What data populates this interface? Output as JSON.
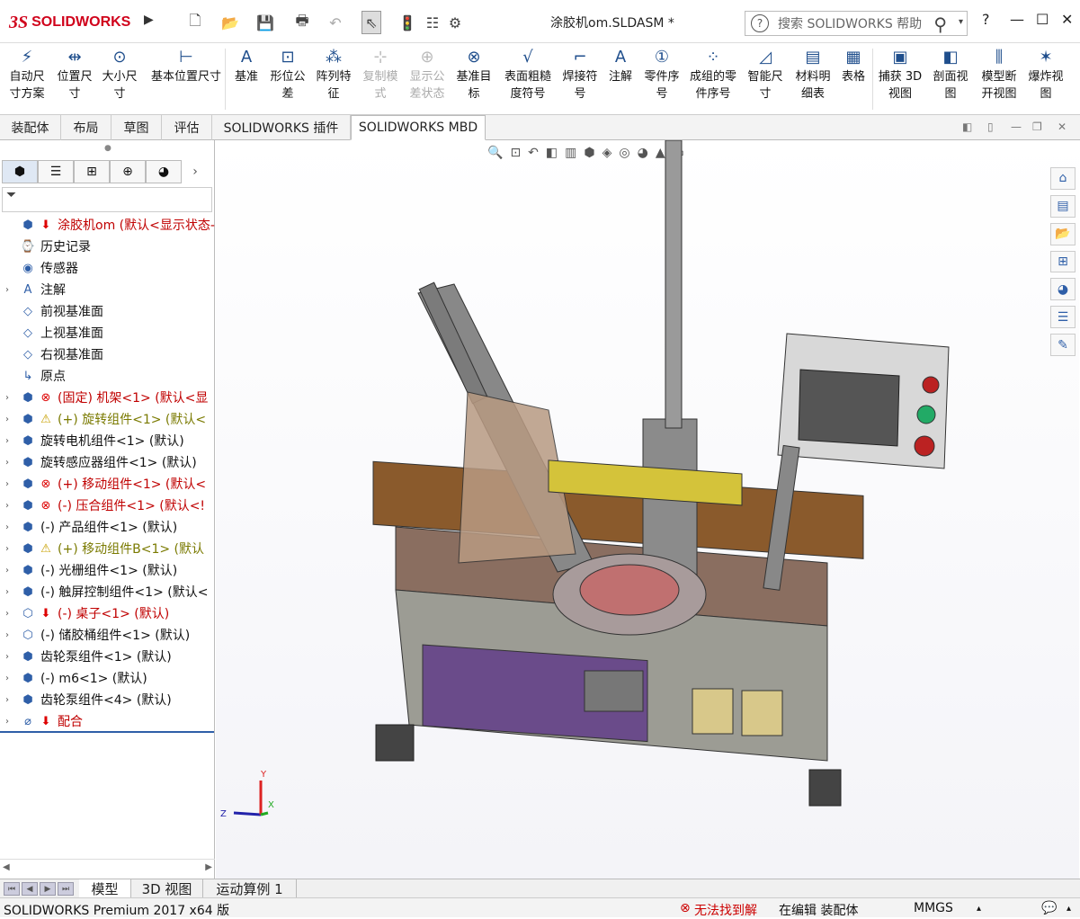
{
  "app": {
    "logo_mark": "3S",
    "logo_text": "SOLIDWORKS",
    "doc_title": "涂胶机om.SLDASM *"
  },
  "search": {
    "placeholder": "搜索 SOLIDWORKS 帮助",
    "help": "?"
  },
  "window": {
    "help": "?",
    "minimize": "—",
    "maximize": "☐",
    "close": "✕"
  },
  "ribbon": [
    {
      "label1": "自动尺",
      "label2": "寸方案",
      "icon": "⚡",
      "enabled": true
    },
    {
      "label1": "位置尺",
      "label2": "寸",
      "icon": "⇹",
      "enabled": true
    },
    {
      "label1": "大小尺",
      "label2": "寸",
      "icon": "⊙",
      "enabled": true
    },
    {
      "label1": "基本位置尺寸",
      "label2": "",
      "icon": "⊢",
      "enabled": true
    },
    {
      "label1": "基准",
      "label2": "",
      "icon": "A",
      "enabled": true
    },
    {
      "label1": "形位公",
      "label2": "差",
      "icon": "⊡",
      "enabled": true
    },
    {
      "label1": "阵列特",
      "label2": "征",
      "icon": "⁂",
      "enabled": true
    },
    {
      "label1": "复制模",
      "label2": "式",
      "icon": "⊹",
      "enabled": false
    },
    {
      "label1": "显示公",
      "label2": "差状态",
      "icon": "⊕",
      "enabled": false
    },
    {
      "label1": "基准目",
      "label2": "标",
      "icon": "⊗",
      "enabled": true
    },
    {
      "label1": "表面粗糙",
      "label2": "度符号",
      "icon": "√",
      "enabled": true
    },
    {
      "label1": "焊接符",
      "label2": "号",
      "icon": "⌐",
      "enabled": true
    },
    {
      "label1": "注解",
      "label2": "",
      "icon": "A",
      "enabled": true
    },
    {
      "label1": "零件序",
      "label2": "号",
      "icon": "①",
      "enabled": true
    },
    {
      "label1": "成组的零",
      "label2": "件序号",
      "icon": "⁘",
      "enabled": true
    },
    {
      "label1": "智能尺",
      "label2": "寸",
      "icon": "◿",
      "enabled": true
    },
    {
      "label1": "材料明",
      "label2": "细表",
      "icon": "▤",
      "enabled": true
    },
    {
      "label1": "表格",
      "label2": "",
      "icon": "▦",
      "enabled": true
    },
    {
      "label1": "捕获 3D",
      "label2": "视图",
      "icon": "▣",
      "enabled": true
    },
    {
      "label1": "剖面视",
      "label2": "图",
      "icon": "◧",
      "enabled": true
    },
    {
      "label1": "模型断",
      "label2": "开视图",
      "icon": "⫼",
      "enabled": true
    },
    {
      "label1": "爆炸视",
      "label2": "图",
      "icon": "✶",
      "enabled": true
    }
  ],
  "tabs": [
    {
      "label": "装配体"
    },
    {
      "label": "布局"
    },
    {
      "label": "草图"
    },
    {
      "label": "评估"
    },
    {
      "label": "SOLIDWORKS 插件"
    },
    {
      "label": "SOLIDWORKS MBD"
    }
  ],
  "tree": [
    {
      "exp": "",
      "icon": "⬢",
      "status": "⬇",
      "label": "涂胶机om (默认<显示状态-",
      "color": "red"
    },
    {
      "exp": "",
      "icon": "⌚",
      "status": "",
      "label": "历史记录",
      "color": ""
    },
    {
      "exp": "",
      "icon": "◉",
      "status": "",
      "label": "传感器",
      "color": ""
    },
    {
      "exp": "›",
      "icon": "A",
      "status": "",
      "label": "注解",
      "color": ""
    },
    {
      "exp": "",
      "icon": "◇",
      "status": "",
      "label": "前视基准面",
      "color": ""
    },
    {
      "exp": "",
      "icon": "◇",
      "status": "",
      "label": "上视基准面",
      "color": ""
    },
    {
      "exp": "",
      "icon": "◇",
      "status": "",
      "label": "右视基准面",
      "color": ""
    },
    {
      "exp": "",
      "icon": "↳",
      "status": "",
      "label": "原点",
      "color": ""
    },
    {
      "exp": "›",
      "icon": "⬢",
      "status": "⊗",
      "label": "(固定) 机架<1> (默认<显",
      "color": "red"
    },
    {
      "exp": "›",
      "icon": "⬢",
      "status": "⚠",
      "label": "(+) 旋转组件<1> (默认<",
      "color": "olive"
    },
    {
      "exp": "›",
      "icon": "⬢",
      "status": "",
      "label": "旋转电机组件<1> (默认)",
      "color": ""
    },
    {
      "exp": "›",
      "icon": "⬢",
      "status": "",
      "label": "旋转感应器组件<1> (默认)",
      "color": ""
    },
    {
      "exp": "›",
      "icon": "⬢",
      "status": "⊗",
      "label": "(+) 移动组件<1> (默认<",
      "color": "red"
    },
    {
      "exp": "›",
      "icon": "⬢",
      "status": "⊗",
      "label": "(-) 压合组件<1> (默认<!",
      "color": "red"
    },
    {
      "exp": "›",
      "icon": "⬢",
      "status": "",
      "label": "(-) 产品组件<1> (默认)",
      "color": ""
    },
    {
      "exp": "›",
      "icon": "⬢",
      "status": "⚠",
      "label": "(+) 移动组件B<1> (默认",
      "color": "olive"
    },
    {
      "exp": "›",
      "icon": "⬢",
      "status": "",
      "label": "(-) 光栅组件<1> (默认)",
      "color": ""
    },
    {
      "exp": "›",
      "icon": "⬢",
      "status": "",
      "label": "(-) 触屏控制组件<1> (默认<",
      "color": ""
    },
    {
      "exp": "›",
      "icon": "⬡",
      "status": "⬇",
      "label": "(-) 桌子<1> (默认)",
      "color": "red"
    },
    {
      "exp": "›",
      "icon": "⬡",
      "status": "",
      "label": "(-) 储胶桶组件<1> (默认)",
      "color": ""
    },
    {
      "exp": "›",
      "icon": "⬢",
      "status": "",
      "label": "齿轮泵组件<1> (默认)",
      "color": ""
    },
    {
      "exp": "›",
      "icon": "⬢",
      "status": "",
      "label": "(-) m6<1> (默认)",
      "color": ""
    },
    {
      "exp": "›",
      "icon": "⬢",
      "status": "",
      "label": "齿轮泵组件<4> (默认)",
      "color": ""
    },
    {
      "exp": "›",
      "icon": "⌀",
      "status": "⬇",
      "label": "配合",
      "color": "red"
    }
  ],
  "triad": {
    "x": "X",
    "y": "Y",
    "z": "Z"
  },
  "bottom_tabs": [
    {
      "label": "模型"
    },
    {
      "label": "3D 视图"
    },
    {
      "label": "运动算例 1"
    }
  ],
  "status": {
    "product": "SOLIDWORKS Premium 2017 x64 版",
    "error": "无法找到解",
    "mode": "在编辑 装配体",
    "units": "MMGS",
    "units_arrow": "▴"
  }
}
